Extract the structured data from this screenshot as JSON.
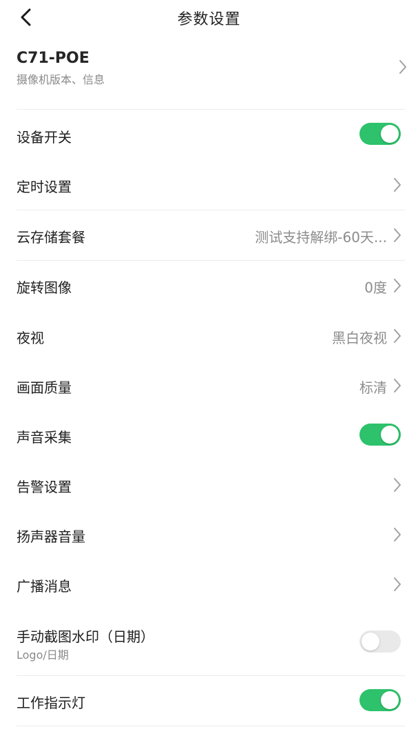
{
  "header": {
    "title": "参数设置",
    "back_icon": "chevron-left-icon"
  },
  "device": {
    "name": "C71-POE",
    "subtitle": "摄像机版本、信息"
  },
  "settings": {
    "device_switch": {
      "label": "设备开关",
      "on": true
    },
    "schedule": {
      "label": "定时设置"
    },
    "cloud_storage": {
      "label": "云存储套餐",
      "value": "测试支持解绑-60天..."
    },
    "rotate_image": {
      "label": "旋转图像",
      "value": "0度"
    },
    "night_vision": {
      "label": "夜视",
      "value": "黑白夜视"
    },
    "image_quality": {
      "label": "画面质量",
      "value": "标清"
    },
    "audio_capture": {
      "label": "声音采集",
      "on": true
    },
    "alarm_settings": {
      "label": "告警设置"
    },
    "speaker_volume": {
      "label": "扬声器音量"
    },
    "broadcast": {
      "label": "广播消息"
    },
    "screenshot_watermark": {
      "label": "手动截图水印（日期）",
      "subtitle": "Logo/日期",
      "on": false
    },
    "work_light": {
      "label": "工作指示灯",
      "on": true
    }
  },
  "colors": {
    "toggle_on": "#2dc26b",
    "toggle_off": "#e9e9e9",
    "divider": "#ececec",
    "value_text": "#8c8c8c"
  }
}
